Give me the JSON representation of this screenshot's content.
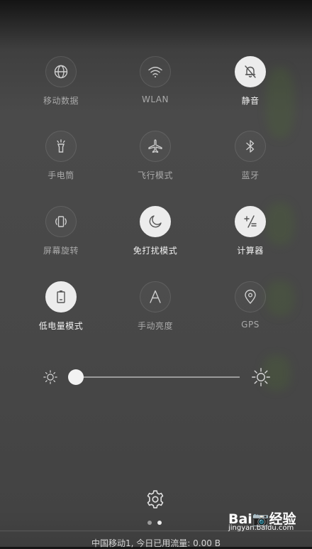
{
  "tiles": [
    {
      "label": "移动数据",
      "icon": "globe-icon",
      "active": false
    },
    {
      "label": "WLAN",
      "icon": "wifi-icon",
      "active": false
    },
    {
      "label": "静音",
      "icon": "bell-slash-icon",
      "active": true
    },
    {
      "label": "手电筒",
      "icon": "flashlight-icon",
      "active": false
    },
    {
      "label": "飞行模式",
      "icon": "airplane-icon",
      "active": false
    },
    {
      "label": "蓝牙",
      "icon": "bluetooth-icon",
      "active": false
    },
    {
      "label": "屏幕旋转",
      "icon": "rotate-icon",
      "active": false
    },
    {
      "label": "免打扰模式",
      "icon": "moon-icon",
      "active": true
    },
    {
      "label": "计算器",
      "icon": "calculator-icon",
      "active": true
    },
    {
      "label": "低电量模式",
      "icon": "battery-icon",
      "active": true
    },
    {
      "label": "手动亮度",
      "icon": "letter-a-icon",
      "active": false
    },
    {
      "label": "GPS",
      "icon": "location-pin-icon",
      "active": false
    }
  ],
  "brightness": {
    "level": 0.0
  },
  "pager": {
    "pages": 2,
    "active": 1
  },
  "status": {
    "carrier_text": "中国移动1, 今日已用流量: 0.00 B"
  },
  "watermark": {
    "logo": "Bai📷经验",
    "url": "jingyan.baidu.com"
  },
  "colors": {
    "active_bg": "#ececec",
    "inactive_icon": "#c9c9c9",
    "active_icon": "#555555"
  }
}
